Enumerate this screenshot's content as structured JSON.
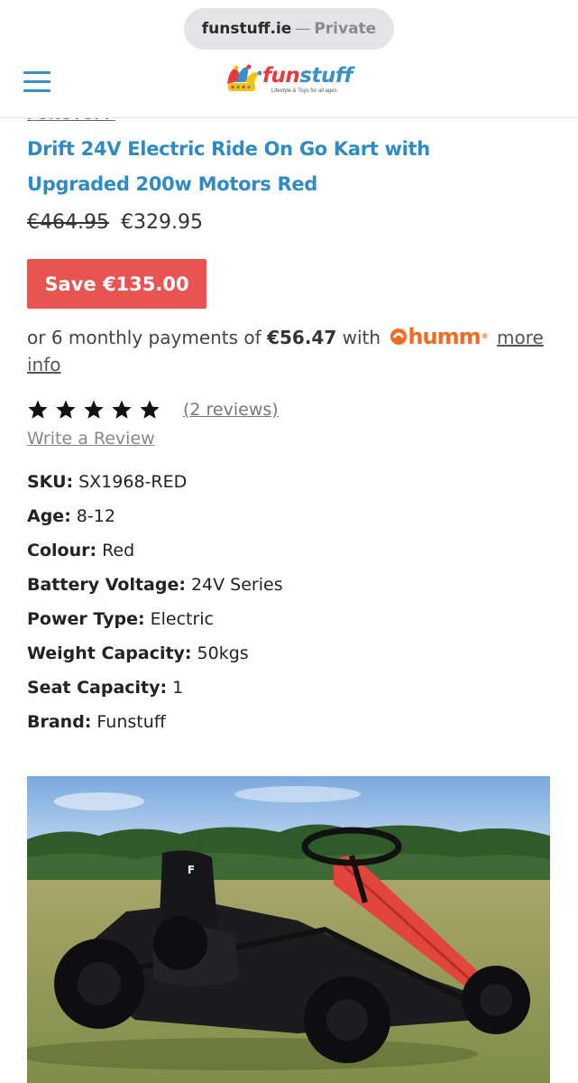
{
  "browser": {
    "domain": "funstuff.ie",
    "separator": "—",
    "mode": "Private"
  },
  "header": {
    "logo_fun": "fun",
    "logo_stuff": "stuff",
    "logo_tagline": "Lifestyle & Toys for all ages"
  },
  "product": {
    "vendor": "FUNSTUFF",
    "title": "Drift 24V Electric Ride On Go Kart with Upgraded 200w Motors Red",
    "old_price": "€464.95",
    "price": "€329.95",
    "save_label": "Save €135.00",
    "payments_prefix": "or 6 monthly payments of",
    "payments_amount": "€56.47",
    "payments_with": "with",
    "humm_label": "humm",
    "humm_reg": "®",
    "more_info": "more info",
    "rating_stars": 5,
    "reviews_link": "(2 reviews)",
    "write_review": "Write a Review",
    "specs": [
      {
        "key": "SKU:",
        "value": "SX1968-RED"
      },
      {
        "key": "Age:",
        "value": "8-12"
      },
      {
        "key": "Colour:",
        "value": "Red"
      },
      {
        "key": "Battery Voltage:",
        "value": "24V Series"
      },
      {
        "key": "Power Type:",
        "value": "Electric"
      },
      {
        "key": "Weight Capacity:",
        "value": "50kgs"
      },
      {
        "key": "Seat Capacity:",
        "value": "1"
      },
      {
        "key": "Brand:",
        "value": "Funstuff"
      }
    ]
  },
  "colors": {
    "brand_blue": "#2f8bc4",
    "brand_red": "#e8393b",
    "save_badge": "#e85451",
    "humm_orange": "#f26b21"
  },
  "icons": {
    "menu": "hamburger-menu-icon",
    "logo": "jester-hat-logo-icon",
    "star": "star-icon",
    "humm": "humm-logo-icon"
  }
}
